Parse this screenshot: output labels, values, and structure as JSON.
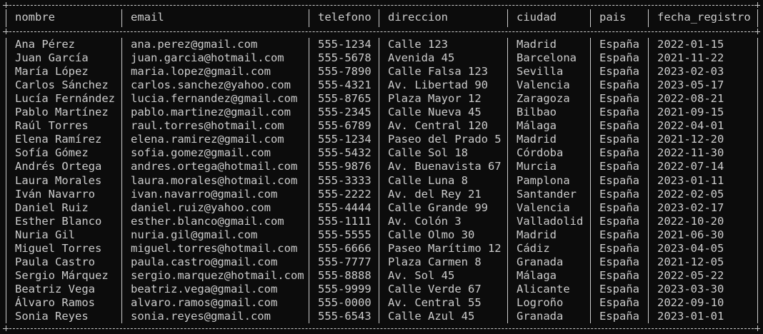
{
  "table": {
    "columns": [
      "nombre",
      "email",
      "telefono",
      "direccion",
      "ciudad",
      "pais",
      "fecha_registro"
    ],
    "rows": [
      [
        "Ana Pérez",
        "ana.perez@gmail.com",
        "555-1234",
        "Calle 123",
        "Madrid",
        "España",
        "2022-01-15"
      ],
      [
        "Juan García",
        "juan.garcia@hotmail.com",
        "555-5678",
        "Avenida 45",
        "Barcelona",
        "España",
        "2021-11-22"
      ],
      [
        "María López",
        "maria.lopez@gmail.com",
        "555-7890",
        "Calle Falsa 123",
        "Sevilla",
        "España",
        "2023-02-03"
      ],
      [
        "Carlos Sánchez",
        "carlos.sanchez@yahoo.com",
        "555-4321",
        "Av. Libertad 90",
        "Valencia",
        "España",
        "2023-05-17"
      ],
      [
        "Lucía Fernández",
        "lucia.fernandez@gmail.com",
        "555-8765",
        "Plaza Mayor 12",
        "Zaragoza",
        "España",
        "2022-08-21"
      ],
      [
        "Pablo Martínez",
        "pablo.martinez@gmail.com",
        "555-2345",
        "Calle Nueva 45",
        "Bilbao",
        "España",
        "2021-09-15"
      ],
      [
        "Raúl Torres",
        "raul.torres@hotmail.com",
        "555-6789",
        "Av. Central 120",
        "Málaga",
        "España",
        "2022-04-01"
      ],
      [
        "Elena Ramírez",
        "elena.ramirez@gmail.com",
        "555-1234",
        "Paseo del Prado 5",
        "Madrid",
        "España",
        "2021-12-20"
      ],
      [
        "Sofía Gómez",
        "sofia.gomez@gmail.com",
        "555-5432",
        "Calle Sol 18",
        "Córdoba",
        "España",
        "2022-11-30"
      ],
      [
        "Andrés Ortega",
        "andres.ortega@hotmail.com",
        "555-9876",
        "Av. Buenavista 67",
        "Murcia",
        "España",
        "2022-07-14"
      ],
      [
        "Laura Morales",
        "laura.morales@hotmail.com",
        "555-3333",
        "Calle Luna 8",
        "Pamplona",
        "España",
        "2023-01-11"
      ],
      [
        "Iván Navarro",
        "ivan.navarro@gmail.com",
        "555-2222",
        "Av. del Rey 21",
        "Santander",
        "España",
        "2022-02-05"
      ],
      [
        "Daniel Ruiz",
        "daniel.ruiz@yahoo.com",
        "555-4444",
        "Calle Grande 99",
        "Valencia",
        "España",
        "2023-02-17"
      ],
      [
        "Esther Blanco",
        "esther.blanco@gmail.com",
        "555-1111",
        "Av. Colón 3",
        "Valladolid",
        "España",
        "2022-10-20"
      ],
      [
        "Nuria Gil",
        "nuria.gil@gmail.com",
        "555-5555",
        "Calle Olmo 30",
        "Madrid",
        "España",
        "2021-06-30"
      ],
      [
        "Miguel Torres",
        "miguel.torres@hotmail.com",
        "555-6666",
        "Paseo Marítimo 12",
        "Cádiz",
        "España",
        "2023-04-05"
      ],
      [
        "Paula Castro",
        "paula.castro@gmail.com",
        "555-7777",
        "Plaza Carmen 8",
        "Granada",
        "España",
        "2021-12-05"
      ],
      [
        "Sergio Márquez",
        "sergio.marquez@hotmail.com",
        "555-8888",
        "Av. Sol 45",
        "Málaga",
        "España",
        "2022-05-22"
      ],
      [
        "Beatriz Vega",
        "beatriz.vega@gmail.com",
        "555-9999",
        "Calle Verde 67",
        "Alicante",
        "España",
        "2023-03-30"
      ],
      [
        "Álvaro Ramos",
        "alvaro.ramos@gmail.com",
        "555-0000",
        "Av. Central 55",
        "Logroño",
        "España",
        "2022-09-10"
      ],
      [
        "Sonia Reyes",
        "sonia.reyes@gmail.com",
        "555-6543",
        "Calle Azul 45",
        "Granada",
        "España",
        "2023-01-01"
      ]
    ]
  }
}
